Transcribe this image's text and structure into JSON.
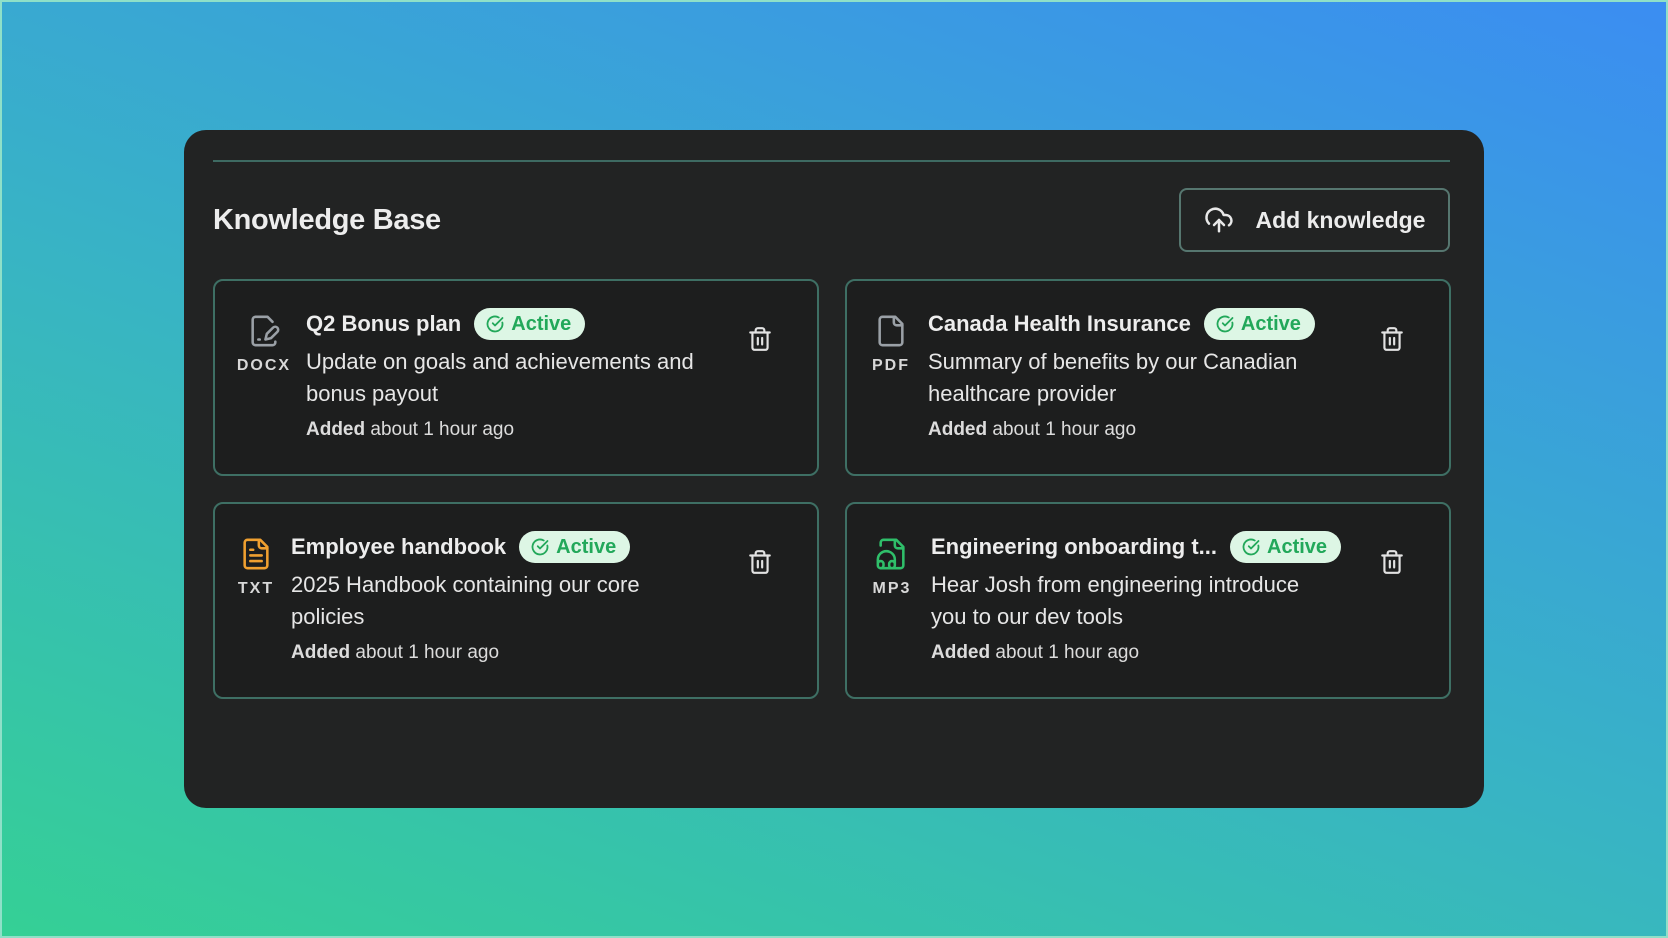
{
  "page": {
    "title": "Knowledge Base"
  },
  "toolbar": {
    "add_label": "Add knowledge",
    "add_icon": "cloud-upload-icon"
  },
  "status_colors": {
    "active_bg": "#ddf6e5",
    "active_fg": "#22a85a"
  },
  "items": [
    {
      "title": "Q2 Bonus plan",
      "type": "DOCX",
      "icon": "file-signature-icon",
      "icon_color": "#9aa0a6",
      "status": "Active",
      "description": "Update on goals and achievements and bonus payout",
      "added_prefix": "Added",
      "added_time": "about 1 hour ago"
    },
    {
      "title": "Canada Health Insurance",
      "type": "PDF",
      "icon": "file-icon",
      "icon_color": "#9aa0a6",
      "status": "Active",
      "description": "Summary of benefits by our Canadian healthcare provider",
      "added_prefix": "Added",
      "added_time": "about 1 hour ago"
    },
    {
      "title": "Employee handbook",
      "type": "TXT",
      "icon": "file-text-icon",
      "icon_color": "#f0a030",
      "status": "Active",
      "description": "2025 Handbook containing our core policies",
      "added_prefix": "Added",
      "added_time": "about 1 hour ago"
    },
    {
      "title": "Engineering onboarding t...",
      "type": "MP3",
      "icon": "file-audio-icon",
      "icon_color": "#2fbf6a",
      "status": "Active",
      "description": "Hear Josh from engineering introduce you to our dev tools",
      "added_prefix": "Added",
      "added_time": "about 1 hour ago"
    }
  ]
}
